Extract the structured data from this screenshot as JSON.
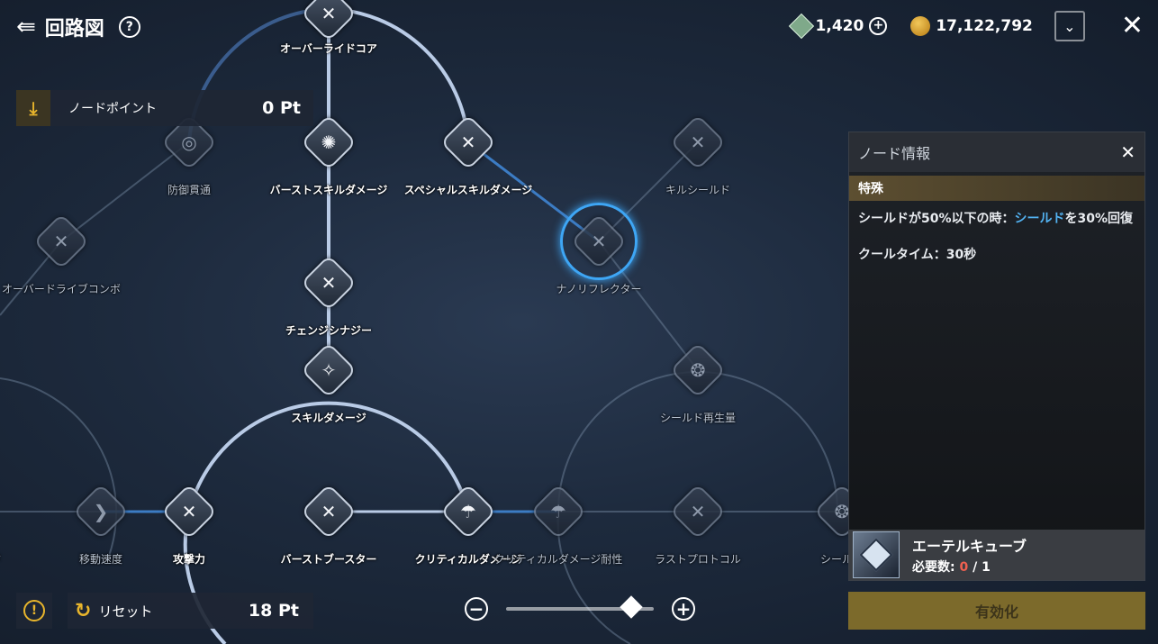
{
  "header": {
    "title": "回路図",
    "gems": "1,420",
    "gold": "17,122,792"
  },
  "node_points": {
    "label": "ノードポイント",
    "value": "0 Pt"
  },
  "reset": {
    "label": "リセット",
    "value": "18 Pt"
  },
  "zoom": {
    "level": 0.85
  },
  "nodes": [
    {
      "name": "オーバーライドコア",
      "glyph": "✕",
      "locked": false
    },
    {
      "name": "防御貫通",
      "glyph": "◎",
      "locked": true
    },
    {
      "name": "バーストスキルダメージ",
      "glyph": "✺",
      "locked": false
    },
    {
      "name": "スペシャルスキルダメージ",
      "glyph": "✕",
      "locked": false
    },
    {
      "name": "キルシールド",
      "glyph": "✕",
      "locked": true
    },
    {
      "name": "オーバードライブコンボ",
      "glyph": "✕",
      "locked": true
    },
    {
      "name": "ナノリフレクター",
      "glyph": "✕",
      "locked": true,
      "selected": true
    },
    {
      "name": "チェンジシナジー",
      "glyph": "✕",
      "locked": false
    },
    {
      "name": "スキルダメージ",
      "glyph": "✧",
      "locked": false
    },
    {
      "name": "シールド再生量",
      "glyph": "❂",
      "locked": true
    },
    {
      "name": "ード",
      "glyph": "",
      "locked": true
    },
    {
      "name": "移動速度",
      "glyph": "❯",
      "locked": true
    },
    {
      "name": "攻撃力",
      "glyph": "✕",
      "locked": false
    },
    {
      "name": "バーストブースター",
      "glyph": "✕",
      "locked": false
    },
    {
      "name": "クリティカルダメージ",
      "glyph": "☂",
      "locked": false
    },
    {
      "name": "クリティカルダメージ耐性",
      "glyph": "☂",
      "locked": true
    },
    {
      "name": "ラストプロトコル",
      "glyph": "✕",
      "locked": true
    },
    {
      "name": "シールド",
      "glyph": "❂",
      "locked": true
    }
  ],
  "panel": {
    "title": "ノード情報",
    "category": "特殊",
    "desc_pre": "シールドが50%以下の時：",
    "desc_hl": "シールド",
    "desc_post": "を30%回復",
    "cooldown": "クールタイム：30秒",
    "cost_name": "エーテルキューブ",
    "cost_req_label": "必要数: ",
    "cost_have": "0",
    "cost_need": " / 1"
  },
  "activate": {
    "label": "有効化"
  },
  "colors": {
    "accent": "#3ea6f5",
    "gold": "#e8b52c",
    "button": "#7c6a2b"
  }
}
